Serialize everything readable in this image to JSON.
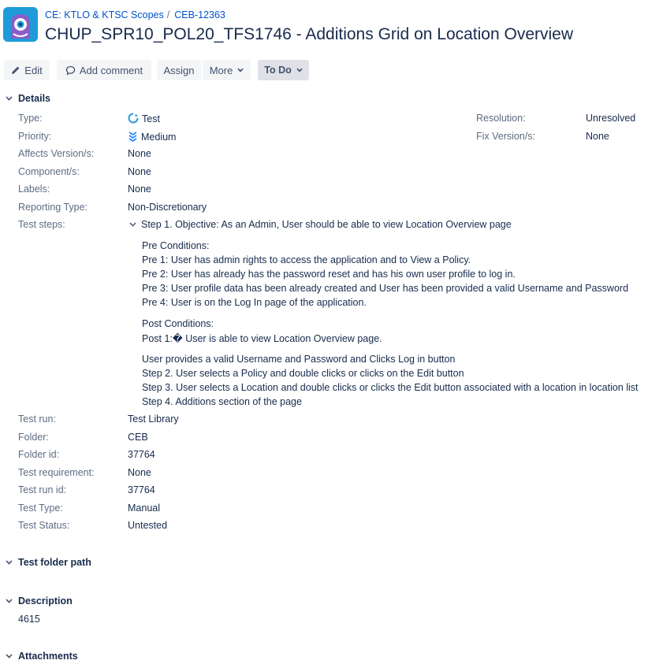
{
  "header": {
    "project_name": "CE: KTLO & KTSC Scopes",
    "separator": "/",
    "issue_key": "CEB-12363",
    "title": "CHUP_SPR10_POL20_TFS1746 - Additions Grid on Location Overview"
  },
  "toolbar": {
    "edit_label": "Edit",
    "comment_label": "Add comment",
    "assign_label": "Assign",
    "more_label": "More",
    "status_label": "To Do"
  },
  "details": {
    "section_title": "Details",
    "fields": {
      "type": {
        "label": "Type:",
        "value": "Test"
      },
      "priority": {
        "label": "Priority:",
        "value": "Medium"
      },
      "affects_version": {
        "label": "Affects Version/s:",
        "value": "None"
      },
      "components": {
        "label": "Component/s:",
        "value": "None"
      },
      "labels": {
        "label": "Labels:",
        "value": "None"
      },
      "reporting_type": {
        "label": "Reporting Type:",
        "value": "Non-Discretionary"
      },
      "test_steps": {
        "label": "Test steps:"
      },
      "resolution": {
        "label": "Resolution:",
        "value": "Unresolved"
      },
      "fix_version": {
        "label": "Fix Version/s:",
        "value": "None"
      },
      "test_run": {
        "label": "Test run:",
        "value": "Test Library"
      },
      "folder": {
        "label": "Folder:",
        "value": "CEB"
      },
      "folder_id": {
        "label": "Folder id:",
        "value": "37764"
      },
      "test_requirement": {
        "label": "Test requirement:",
        "value": "None"
      },
      "test_run_id": {
        "label": "Test run id:",
        "value": "37764"
      },
      "test_type": {
        "label": "Test Type:",
        "value": "Manual"
      },
      "test_status": {
        "label": "Test Status:",
        "value": "Untested"
      }
    },
    "test_steps": {
      "step_header": "Step 1. Objective: As an Admin, User should be able to view Location Overview page",
      "pre_title": "Pre Conditions:",
      "pre": [
        "Pre 1: User has admin rights to access the application and to View a Policy.",
        "Pre 2: User has already has the password reset and has his own user profile to log in.",
        "Pre 3: User profile data has been already created and User has been provided a valid Username and Password",
        "Pre 4: User is on the Log In page of the application."
      ],
      "post_title": "Post Conditions:",
      "post": [
        "Post 1:� User is able to view Location Overview page."
      ],
      "steps": [
        "User provides a valid Username and Password and Clicks Log in button",
        "Step 2. User selects a Policy and double clicks or clicks on the Edit button",
        "Step 3. User selects a Location and double clicks or clicks the Edit button associated with a location in location list",
        "Step 4. Additions section of the page"
      ]
    }
  },
  "test_folder_path": {
    "section_title": "Test folder path"
  },
  "description": {
    "section_title": "Description",
    "value": "4615"
  },
  "attachments": {
    "section_title": "Attachments"
  },
  "colors": {
    "link": "#0052cc",
    "text": "#172b4d",
    "label": "#5e6c84",
    "button_bg": "#f4f5f7",
    "status_bg": "#dfe1e6"
  }
}
